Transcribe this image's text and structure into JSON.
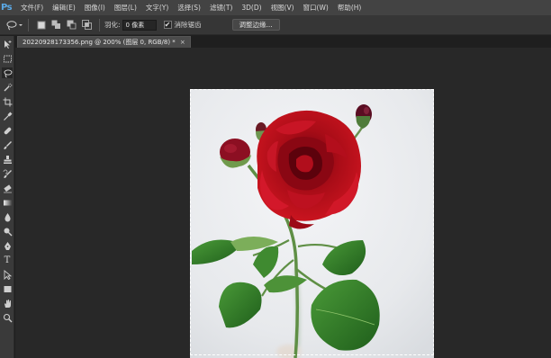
{
  "app": {
    "logo": "Ps"
  },
  "menu": [
    "文件(F)",
    "编辑(E)",
    "图像(I)",
    "图层(L)",
    "文字(Y)",
    "选择(S)",
    "滤镜(T)",
    "3D(D)",
    "视图(V)",
    "窗口(W)",
    "帮助(H)"
  ],
  "options": {
    "feather_label": "羽化:",
    "feather_value": "0 像素",
    "antialias_label": "消除锯齿",
    "antialias_checked": "✔",
    "refine_edge_label": "调整边缘..."
  },
  "document": {
    "tab_label": "20220928173356.png @ 200% (图层 0, RGB/8) *",
    "close_glyph": "×"
  },
  "tools": [
    "move-icon",
    "rect-marquee-icon",
    "lasso-icon",
    "quick-select-icon",
    "crop-icon",
    "eyedropper-icon",
    "healing-brush-icon",
    "brush-icon",
    "clone-stamp-icon",
    "history-brush-icon",
    "eraser-icon",
    "gradient-icon",
    "blur-icon",
    "dodge-icon",
    "pen-icon",
    "type-icon",
    "path-select-icon",
    "shape-icon",
    "hand-icon",
    "zoom-icon"
  ],
  "tool_type_glyph": "T",
  "colors": {
    "menubar": "#434343",
    "optionsbar": "#363636",
    "workspace": "#282828",
    "accent_logo": "#5aa9e6",
    "rose_red": "#b0121c",
    "leaf_green": "#2f7a2a"
  }
}
